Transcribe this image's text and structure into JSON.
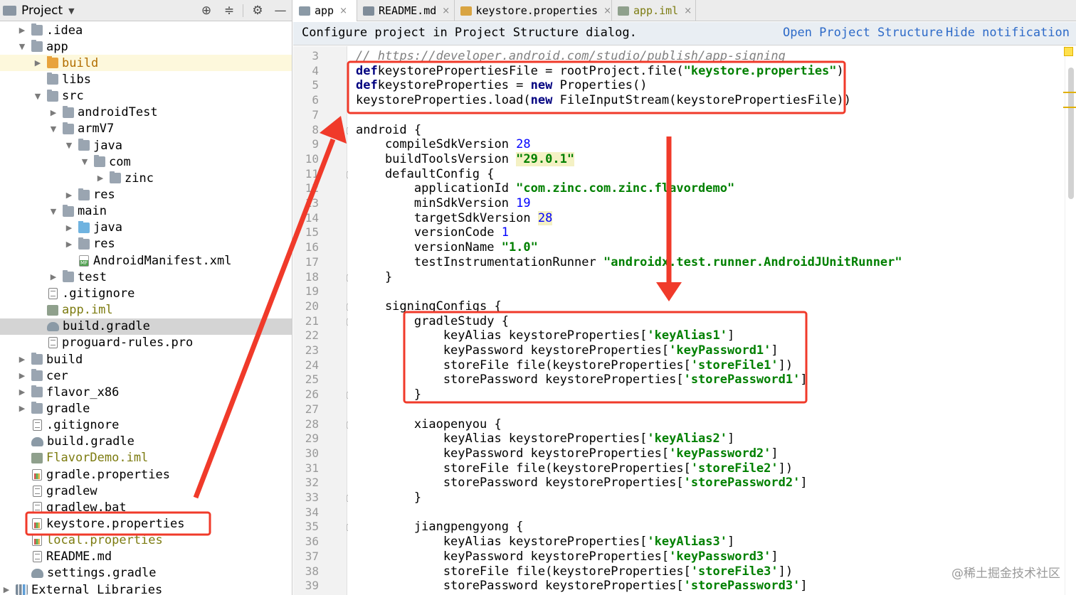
{
  "project_panel": {
    "title": "Project",
    "tree": [
      {
        "label": "idea_label",
        "text": ".idea",
        "level": 1,
        "twisty": "▶",
        "icon": "folder",
        "style": ""
      },
      {
        "text": "app",
        "level": 1,
        "twisty": "▼",
        "icon": "folder",
        "style": ""
      },
      {
        "text": "build",
        "level": 2,
        "twisty": "▶",
        "icon": "folder-orange",
        "style": "orange",
        "row": "hl"
      },
      {
        "text": "libs",
        "level": 2,
        "twisty": "",
        "icon": "folder",
        "style": ""
      },
      {
        "text": "src",
        "level": 2,
        "twisty": "▼",
        "icon": "folder",
        "style": ""
      },
      {
        "text": "androidTest",
        "level": 3,
        "twisty": "▶",
        "icon": "folder",
        "style": ""
      },
      {
        "text": "armV7",
        "level": 3,
        "twisty": "▼",
        "icon": "folder",
        "style": ""
      },
      {
        "text": "java",
        "level": 4,
        "twisty": "▼",
        "icon": "folder",
        "style": ""
      },
      {
        "text": "com",
        "level": 5,
        "twisty": "▼",
        "icon": "folder",
        "style": ""
      },
      {
        "text": "zinc",
        "level": 6,
        "twisty": "▶",
        "icon": "folder",
        "style": ""
      },
      {
        "text": "res",
        "level": 4,
        "twisty": "▶",
        "icon": "folder",
        "style": ""
      },
      {
        "text": "main",
        "level": 3,
        "twisty": "▼",
        "icon": "folder",
        "style": ""
      },
      {
        "text": "java",
        "level": 4,
        "twisty": "▶",
        "icon": "folder-blue",
        "style": ""
      },
      {
        "text": "res",
        "level": 4,
        "twisty": "▶",
        "icon": "folder",
        "style": ""
      },
      {
        "text": "AndroidManifest.xml",
        "level": 4,
        "twisty": "",
        "icon": "xml",
        "style": ""
      },
      {
        "text": "test",
        "level": 3,
        "twisty": "▶",
        "icon": "folder",
        "style": ""
      },
      {
        "text": ".gitignore",
        "level": 2,
        "twisty": "",
        "icon": "file",
        "style": ""
      },
      {
        "text": "app.iml",
        "level": 2,
        "twisty": "",
        "icon": "iml",
        "style": "olive"
      },
      {
        "text": "build.gradle",
        "level": 2,
        "twisty": "",
        "icon": "gradle",
        "style": "",
        "row": "sel"
      },
      {
        "text": "proguard-rules.pro",
        "level": 2,
        "twisty": "",
        "icon": "file",
        "style": ""
      },
      {
        "text": "build",
        "level": 1,
        "twisty": "▶",
        "icon": "folder",
        "style": ""
      },
      {
        "text": "cer",
        "level": 1,
        "twisty": "▶",
        "icon": "folder",
        "style": ""
      },
      {
        "text": "flavor_x86",
        "level": 1,
        "twisty": "▶",
        "icon": "folder",
        "style": ""
      },
      {
        "text": "gradle",
        "level": 1,
        "twisty": "▶",
        "icon": "folder",
        "style": ""
      },
      {
        "text": ".gitignore",
        "level": 1,
        "twisty": "",
        "icon": "file",
        "style": ""
      },
      {
        "text": "build.gradle",
        "level": 1,
        "twisty": "",
        "icon": "gradle",
        "style": ""
      },
      {
        "text": "FlavorDemo.iml",
        "level": 1,
        "twisty": "",
        "icon": "iml",
        "style": "olive"
      },
      {
        "text": "gradle.properties",
        "level": 1,
        "twisty": "",
        "icon": "props",
        "style": ""
      },
      {
        "text": "gradlew",
        "level": 1,
        "twisty": "",
        "icon": "file",
        "style": ""
      },
      {
        "text": "gradlew.bat",
        "level": 1,
        "twisty": "",
        "icon": "file",
        "style": ""
      },
      {
        "text": "keystore.properties",
        "level": 1,
        "twisty": "",
        "icon": "props",
        "style": ""
      },
      {
        "text": "local.properties",
        "level": 1,
        "twisty": "",
        "icon": "props",
        "style": "olive"
      },
      {
        "text": "README.md",
        "level": 1,
        "twisty": "",
        "icon": "file",
        "style": ""
      },
      {
        "text": "settings.gradle",
        "level": 1,
        "twisty": "",
        "icon": "gradle",
        "style": ""
      },
      {
        "text": "External Libraries",
        "level": 0,
        "twisty": "▶",
        "icon": "lib",
        "style": ""
      }
    ]
  },
  "tabs": [
    {
      "label": "app",
      "icon_color": "#8b9aa6",
      "active": true
    },
    {
      "label": "README.md",
      "icon_color": "#7f8c99",
      "active": false
    },
    {
      "label": "keystore.properties",
      "icon_color": "#d9a441",
      "active": false
    },
    {
      "label": "app.iml",
      "icon_color": "#8fa08c",
      "active": false
    }
  ],
  "tab_close_glyph": "×",
  "notification": {
    "message": "Configure project in Project Structure dialog.",
    "link1": "Open Project Structure",
    "link2": "Hide notification"
  },
  "editor": {
    "line_numbers": [
      "3",
      "4",
      "5",
      "6",
      "7",
      "8",
      "9",
      "10",
      "11",
      "12",
      "13",
      "14",
      "15",
      "16",
      "17",
      "18",
      "19",
      "20",
      "21",
      "22",
      "23",
      "24",
      "25",
      "26",
      "27",
      "28",
      "29",
      "30",
      "31",
      "32",
      "33",
      "34",
      "35",
      "36",
      "37",
      "38",
      "39"
    ],
    "lines": [
      [
        [
          "cm",
          "// https://developer.android.com/studio/publish/app-signing"
        ]
      ],
      [
        [
          "kw",
          "def"
        ],
        [
          "",
          "keystorePropertiesFile = rootProject.file("
        ],
        [
          "st",
          "\"keystore.properties\""
        ],
        [
          "",
          ")"
        ]
      ],
      [
        [
          "kw",
          "def"
        ],
        [
          "",
          "keystoreProperties = "
        ],
        [
          "kw",
          "new"
        ],
        [
          "",
          " Properties()"
        ]
      ],
      [
        [
          "",
          "keystoreProperties.load("
        ],
        [
          "kw",
          "new"
        ],
        [
          "",
          " FileInputStream(keystorePropertiesFile))"
        ]
      ],
      [],
      [
        [
          "",
          "android {"
        ]
      ],
      [
        [
          "",
          "    compileSdkVersion "
        ],
        [
          "nm",
          "28"
        ]
      ],
      [
        [
          "",
          "    buildToolsVersion "
        ],
        [
          "st sthl",
          "\"29.0.1\""
        ]
      ],
      [
        [
          "",
          "    defaultConfig {"
        ]
      ],
      [
        [
          "",
          "        applicationId "
        ],
        [
          "st",
          "\"com.zinc.com.zinc.flavordemo\""
        ]
      ],
      [
        [
          "",
          "        minSdkVersion "
        ],
        [
          "nm",
          "19"
        ]
      ],
      [
        [
          "",
          "        targetSdkVersion "
        ],
        [
          "nm sthl",
          "28"
        ]
      ],
      [
        [
          "",
          "        versionCode "
        ],
        [
          "nm",
          "1"
        ]
      ],
      [
        [
          "",
          "        versionName "
        ],
        [
          "st",
          "\"1.0\""
        ]
      ],
      [
        [
          "",
          "        testInstrumentationRunner "
        ],
        [
          "st",
          "\"androidx.test.runner.AndroidJUnitRunner\""
        ]
      ],
      [
        [
          "",
          "    }"
        ]
      ],
      [],
      [
        [
          "",
          "    signingConfigs {"
        ]
      ],
      [
        [
          "",
          "        gradleStudy {"
        ]
      ],
      [
        [
          "",
          "            keyAlias keystoreProperties["
        ],
        [
          "st",
          "'keyAlias1'"
        ],
        [
          "",
          "]"
        ]
      ],
      [
        [
          "",
          "            keyPassword keystoreProperties["
        ],
        [
          "st",
          "'keyPassword1'"
        ],
        [
          "",
          "]"
        ]
      ],
      [
        [
          "",
          "            storeFile file(keystoreProperties["
        ],
        [
          "st",
          "'storeFile1'"
        ],
        [
          "",
          "])"
        ]
      ],
      [
        [
          "",
          "            storePassword keystoreProperties["
        ],
        [
          "st",
          "'storePassword1'"
        ],
        [
          "",
          "]"
        ]
      ],
      [
        [
          "",
          "        }"
        ]
      ],
      [],
      [
        [
          "",
          "        xiaopenyou {"
        ]
      ],
      [
        [
          "",
          "            keyAlias keystoreProperties["
        ],
        [
          "st",
          "'keyAlias2'"
        ],
        [
          "",
          "]"
        ]
      ],
      [
        [
          "",
          "            keyPassword keystoreProperties["
        ],
        [
          "st",
          "'keyPassword2'"
        ],
        [
          "",
          "]"
        ]
      ],
      [
        [
          "",
          "            storeFile file(keystoreProperties["
        ],
        [
          "st",
          "'storeFile2'"
        ],
        [
          "",
          "])"
        ]
      ],
      [
        [
          "",
          "            storePassword keystoreProperties["
        ],
        [
          "st",
          "'storePassword2'"
        ],
        [
          "",
          "]"
        ]
      ],
      [
        [
          "",
          "        }"
        ]
      ],
      [],
      [
        [
          "",
          "        jiangpengyong {"
        ]
      ],
      [
        [
          "",
          "            keyAlias keystoreProperties["
        ],
        [
          "st",
          "'keyAlias3'"
        ],
        [
          "",
          "]"
        ]
      ],
      [
        [
          "",
          "            keyPassword keystoreProperties["
        ],
        [
          "st",
          "'keyPassword3'"
        ],
        [
          "",
          "]"
        ]
      ],
      [
        [
          "",
          "            storeFile file(keystoreProperties["
        ],
        [
          "st",
          "'storeFile3'"
        ],
        [
          "",
          "])"
        ]
      ],
      [
        [
          "",
          "            storePassword keystoreProperties["
        ],
        [
          "st",
          "'storePassword3'"
        ],
        [
          "",
          "]"
        ]
      ]
    ],
    "fold_markers_at": [
      "8",
      "11",
      "18",
      "20",
      "21",
      "26",
      "28",
      "33",
      "35"
    ]
  },
  "annotation_color": "#f03a2a",
  "watermark": "@稀土掘金技术社区"
}
